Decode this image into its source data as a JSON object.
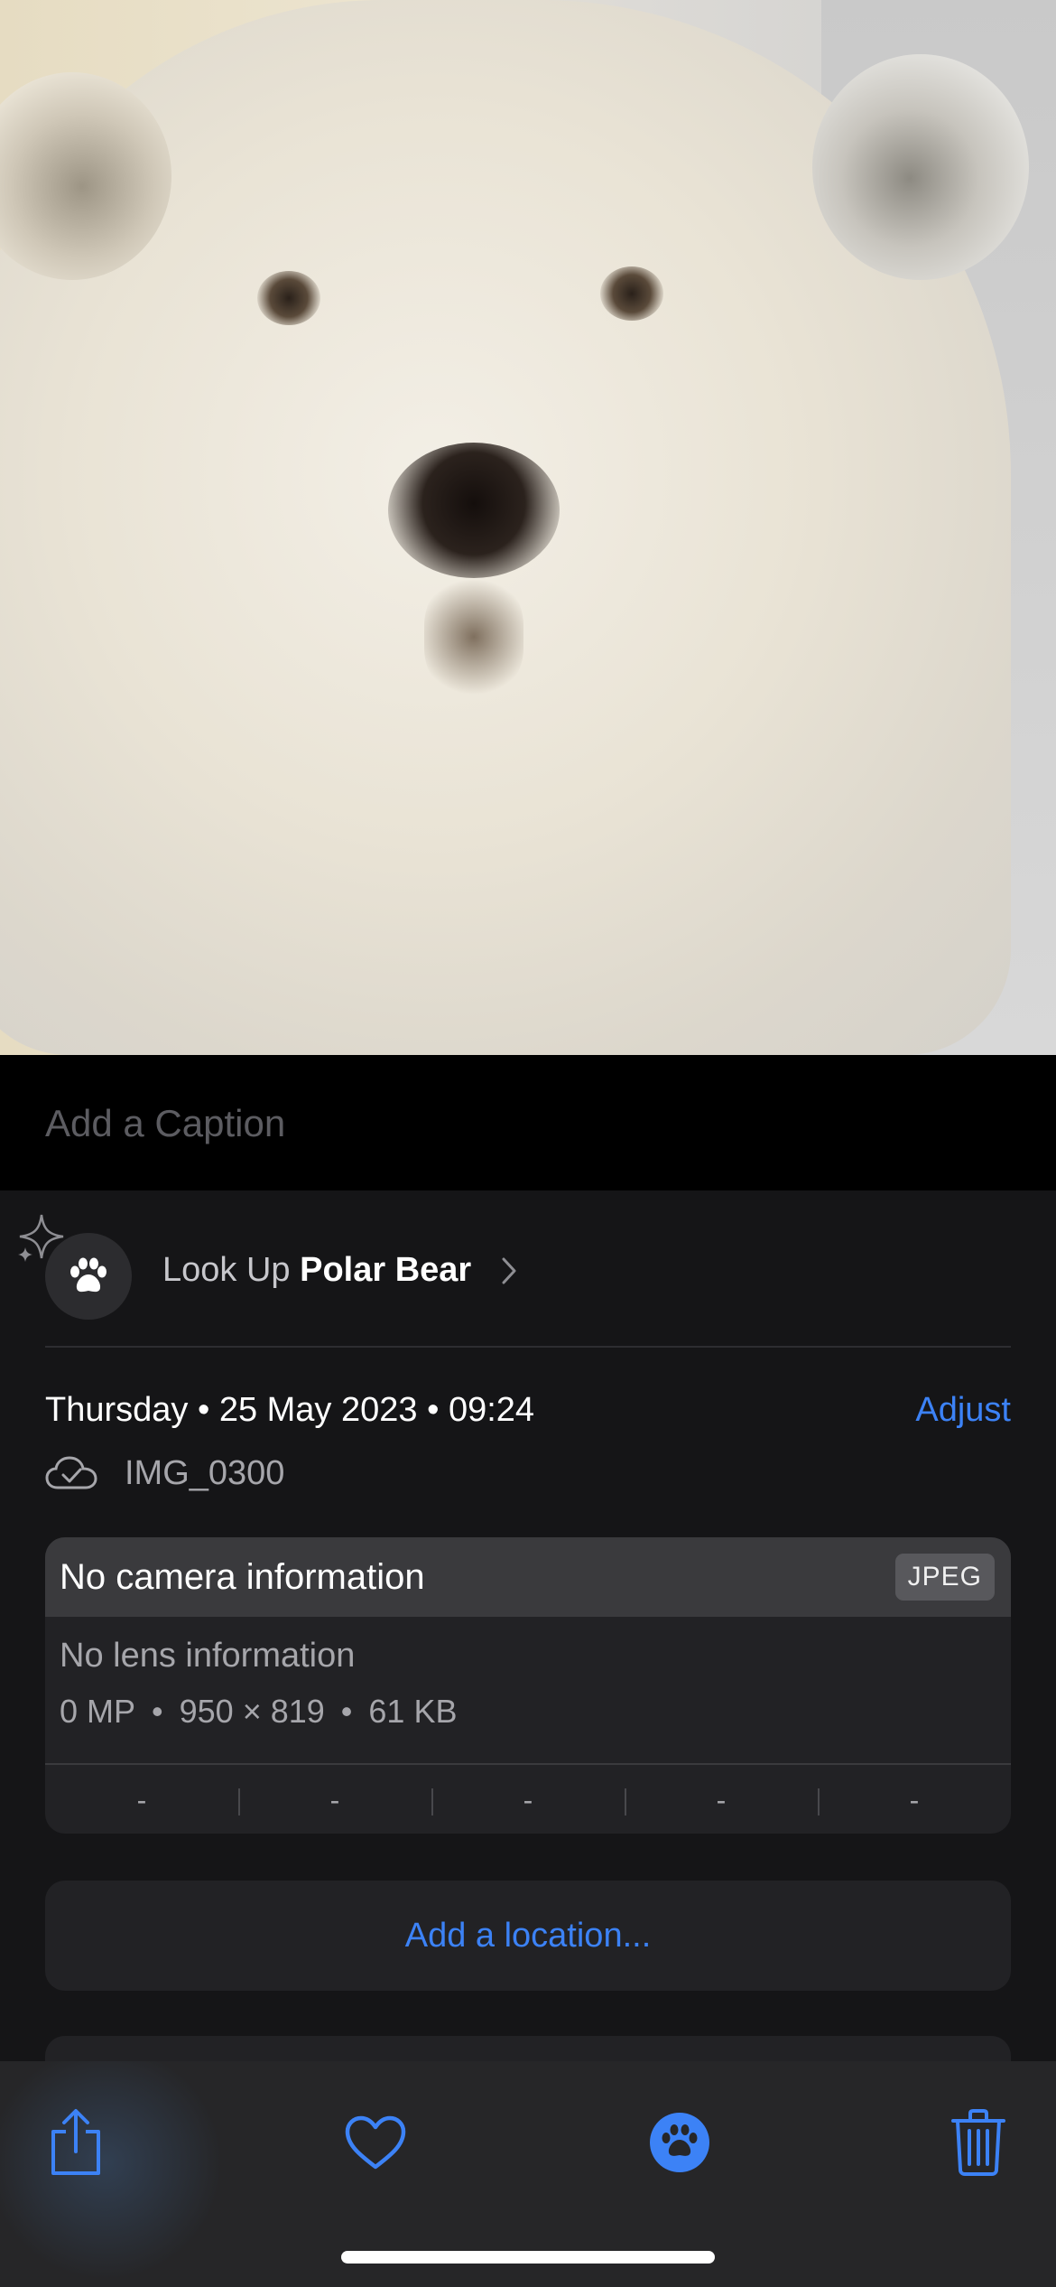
{
  "photo": {
    "subject_icon": "polar-bear-photo"
  },
  "caption": {
    "placeholder": "Add a Caption"
  },
  "lookup": {
    "prefix": "Look Up",
    "subject": "Polar Bear",
    "icon": "paw-icon"
  },
  "info": {
    "datetime": "Thursday • 25 May 2023 • 09:24",
    "adjust_label": "Adjust",
    "filename": "IMG_0300"
  },
  "camera": {
    "title": "No camera information",
    "format": "JPEG",
    "lens": "No lens information",
    "megapixels": "0 MP",
    "resolution": "950 × 819",
    "filesize": "61 KB",
    "stats": [
      "-",
      "-",
      "-",
      "-",
      "-"
    ]
  },
  "location": {
    "label": "Add a location..."
  },
  "toolbar": {
    "items": [
      "share-icon",
      "heart-icon",
      "paw-info-icon",
      "trash-icon"
    ]
  },
  "colors": {
    "accent": "#3c82f6",
    "background": "#151517",
    "card": "#222225"
  }
}
